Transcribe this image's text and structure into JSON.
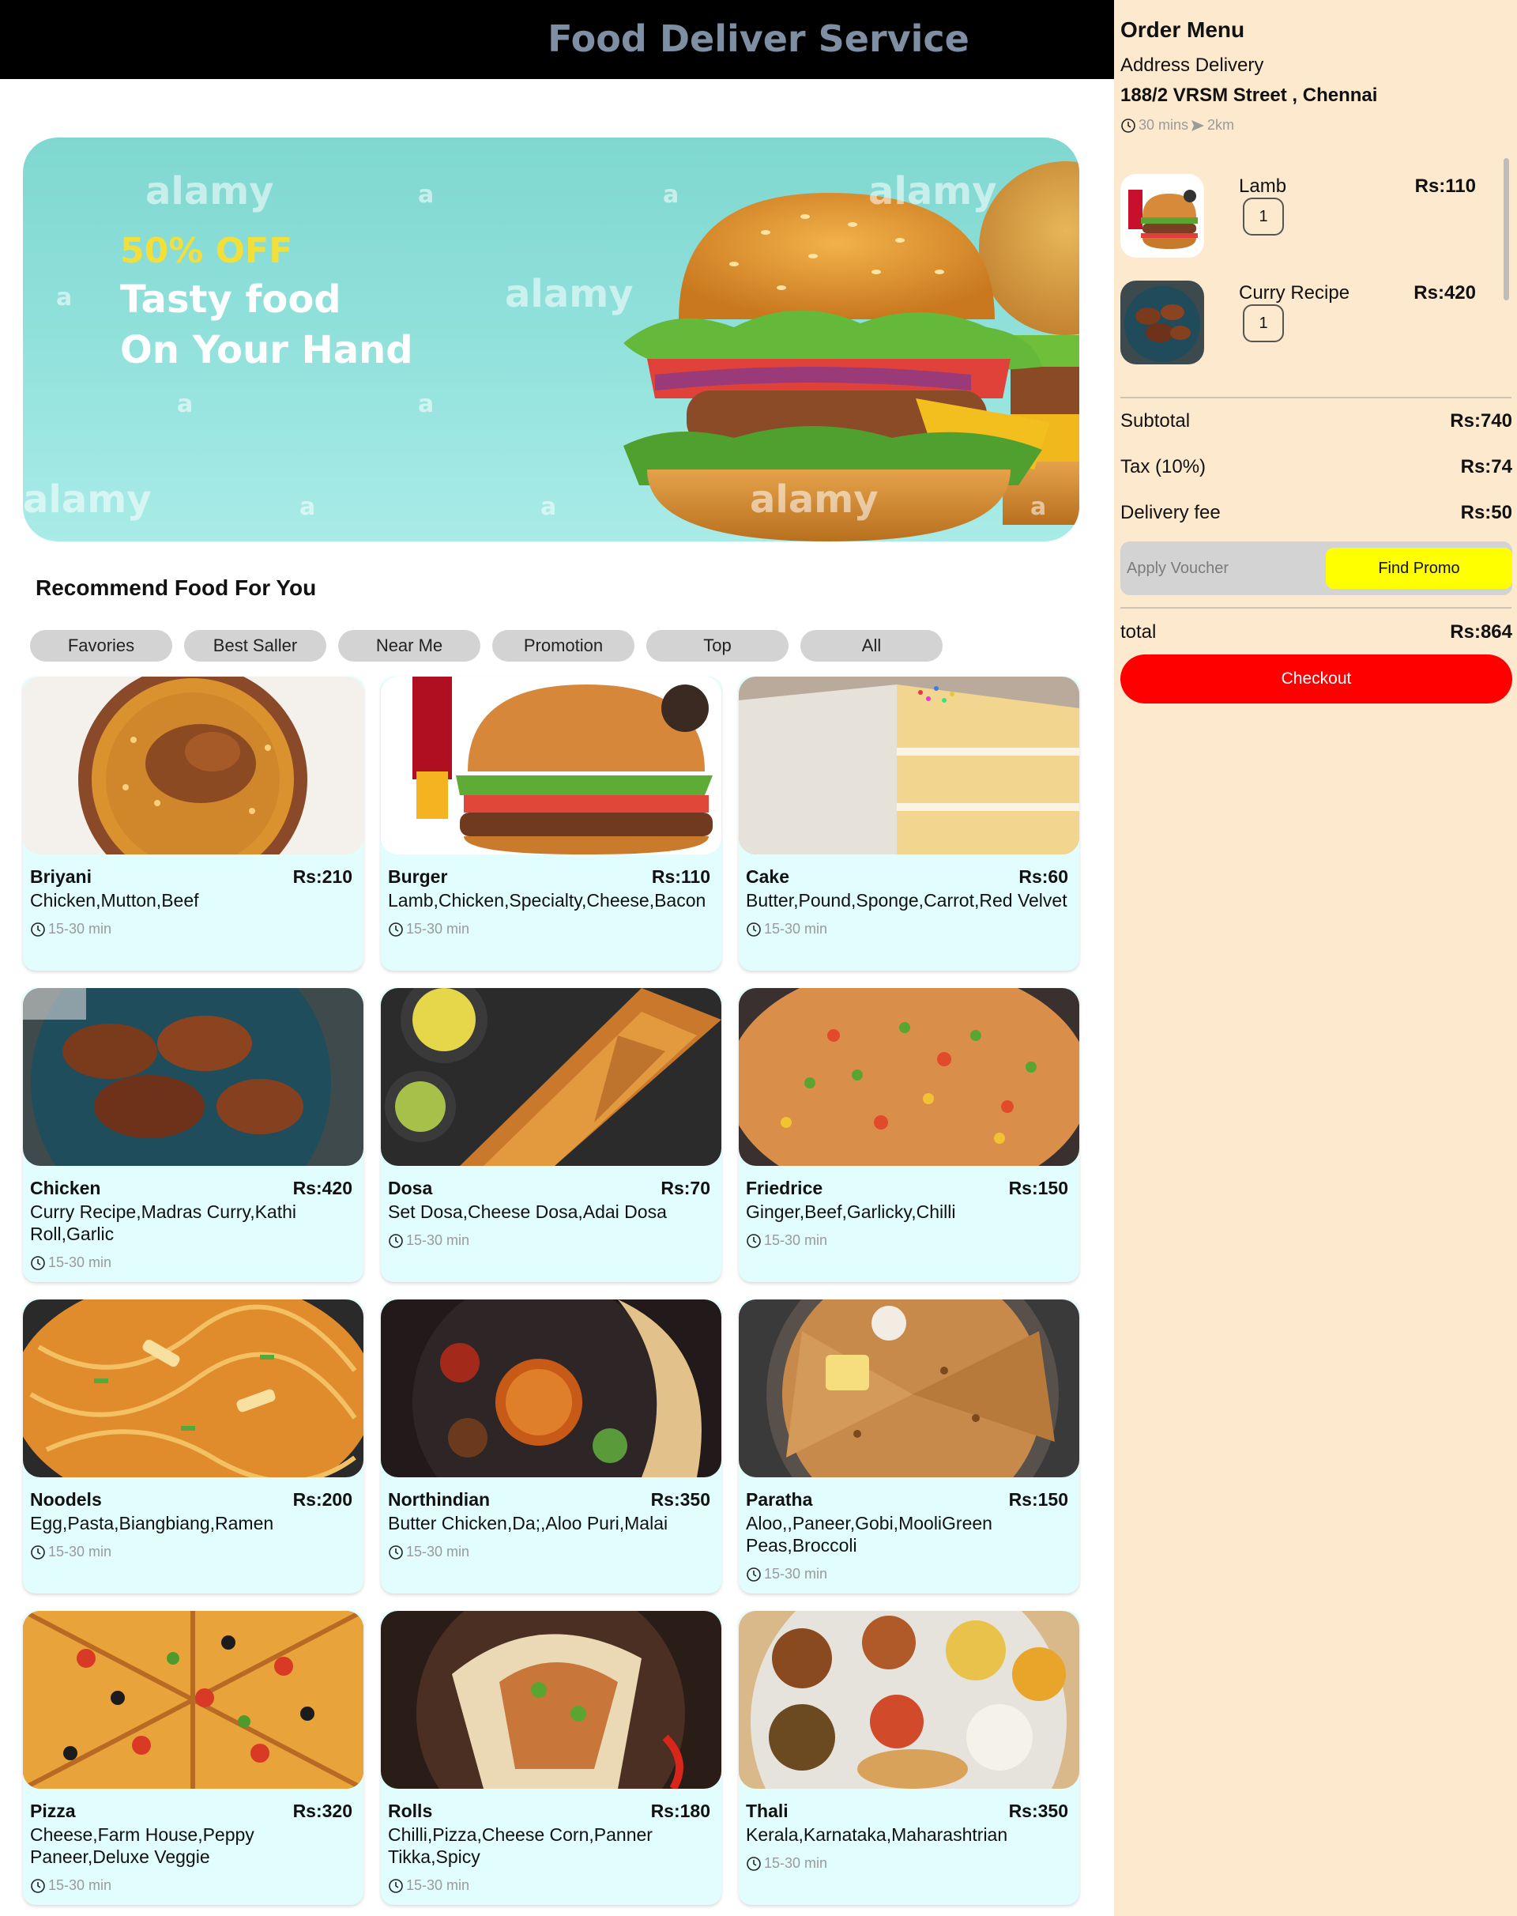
{
  "header": {
    "title": "Food Deliver Service"
  },
  "banner": {
    "discount": "50% OFF",
    "line1": "Tasty food",
    "line2": "On Your Hand",
    "watermark": "alamy",
    "watermark_short": "a"
  },
  "section_title": "Recommend Food For You",
  "filters": [
    "Favories",
    "Best Saller",
    "Near Me",
    "Promotion",
    "Top",
    "All"
  ],
  "foods": [
    {
      "name": "Briyani",
      "price": "Rs:210",
      "desc": "Chicken,Mutton,Beef",
      "time": "15-30 min",
      "icon": "biryani-image"
    },
    {
      "name": "Burger",
      "price": "Rs:110",
      "desc": "Lamb,Chicken,Specialty,Cheese,Bacon",
      "time": "15-30 min",
      "icon": "burger-image"
    },
    {
      "name": "Cake",
      "price": "Rs:60",
      "desc": "Butter,Pound,Sponge,Carrot,Red Velvet",
      "time": "15-30 min",
      "icon": "cake-image"
    },
    {
      "name": "Chicken",
      "price": "Rs:420",
      "desc": "Curry Recipe,Madras Curry,Kathi Roll,Garlic",
      "time": "15-30 min",
      "icon": "chicken-image"
    },
    {
      "name": "Dosa",
      "price": "Rs:70",
      "desc": "Set Dosa,Cheese Dosa,Adai Dosa",
      "time": "15-30 min",
      "icon": "dosa-image"
    },
    {
      "name": "Friedrice",
      "price": "Rs:150",
      "desc": "Ginger,Beef,Garlicky,Chilli",
      "time": "15-30 min",
      "icon": "fried-rice-image"
    },
    {
      "name": "Noodels",
      "price": "Rs:200",
      "desc": "Egg,Pasta,Biangbiang,Ramen",
      "time": "15-30 min",
      "icon": "noodles-image"
    },
    {
      "name": "Northindian",
      "price": "Rs:350",
      "desc": "Butter Chicken,Da;,Aloo Puri,Malai",
      "time": "15-30 min",
      "icon": "north-indian-image"
    },
    {
      "name": "Paratha",
      "price": "Rs:150",
      "desc": "Aloo,,Paneer,Gobi,MooliGreen Peas,Broccoli",
      "time": "15-30 min",
      "icon": "paratha-image"
    },
    {
      "name": "Pizza",
      "price": "Rs:320",
      "desc": "Cheese,Farm House,Peppy Paneer,Deluxe Veggie",
      "time": "15-30 min",
      "icon": "pizza-image"
    },
    {
      "name": "Rolls",
      "price": "Rs:180",
      "desc": "Chilli,Pizza,Cheese Corn,Panner Tikka,Spicy",
      "time": "15-30 min",
      "icon": "rolls-image"
    },
    {
      "name": "Thali",
      "price": "Rs:350",
      "desc": "Kerala,Karnataka,Maharashtrian",
      "time": "15-30 min",
      "icon": "thali-image"
    }
  ],
  "order": {
    "title": "Order Menu",
    "address_label": "Address Delivery",
    "address": "188/2 VRSM Street , Chennai",
    "eta": "30 mins",
    "distance": "2km",
    "items": [
      {
        "name": "Lamb",
        "price": "Rs:110",
        "qty": "1"
      },
      {
        "name": "Curry Recipe",
        "price": "Rs:420",
        "qty": "1"
      }
    ],
    "subtotal_label": "Subtotal",
    "subtotal": "Rs:740",
    "tax_label": "Tax (10%)",
    "tax": "Rs:74",
    "delivery_label": "Delivery fee",
    "delivery": "Rs:50",
    "voucher_placeholder": "Apply Voucher",
    "promo_label": "Find Promo",
    "total_label": "total",
    "total": "Rs:864",
    "checkout_label": "Checkout"
  },
  "colors": {
    "topbar": "#000000",
    "title": "#7f8fa3",
    "panel_bg": "#fde9ce",
    "card_bg": "#e1fdfd",
    "chip_bg": "#d3d3d3",
    "promo": "#ffff00",
    "checkout": "#ff0000",
    "banner_discount": "#f2df3a"
  }
}
